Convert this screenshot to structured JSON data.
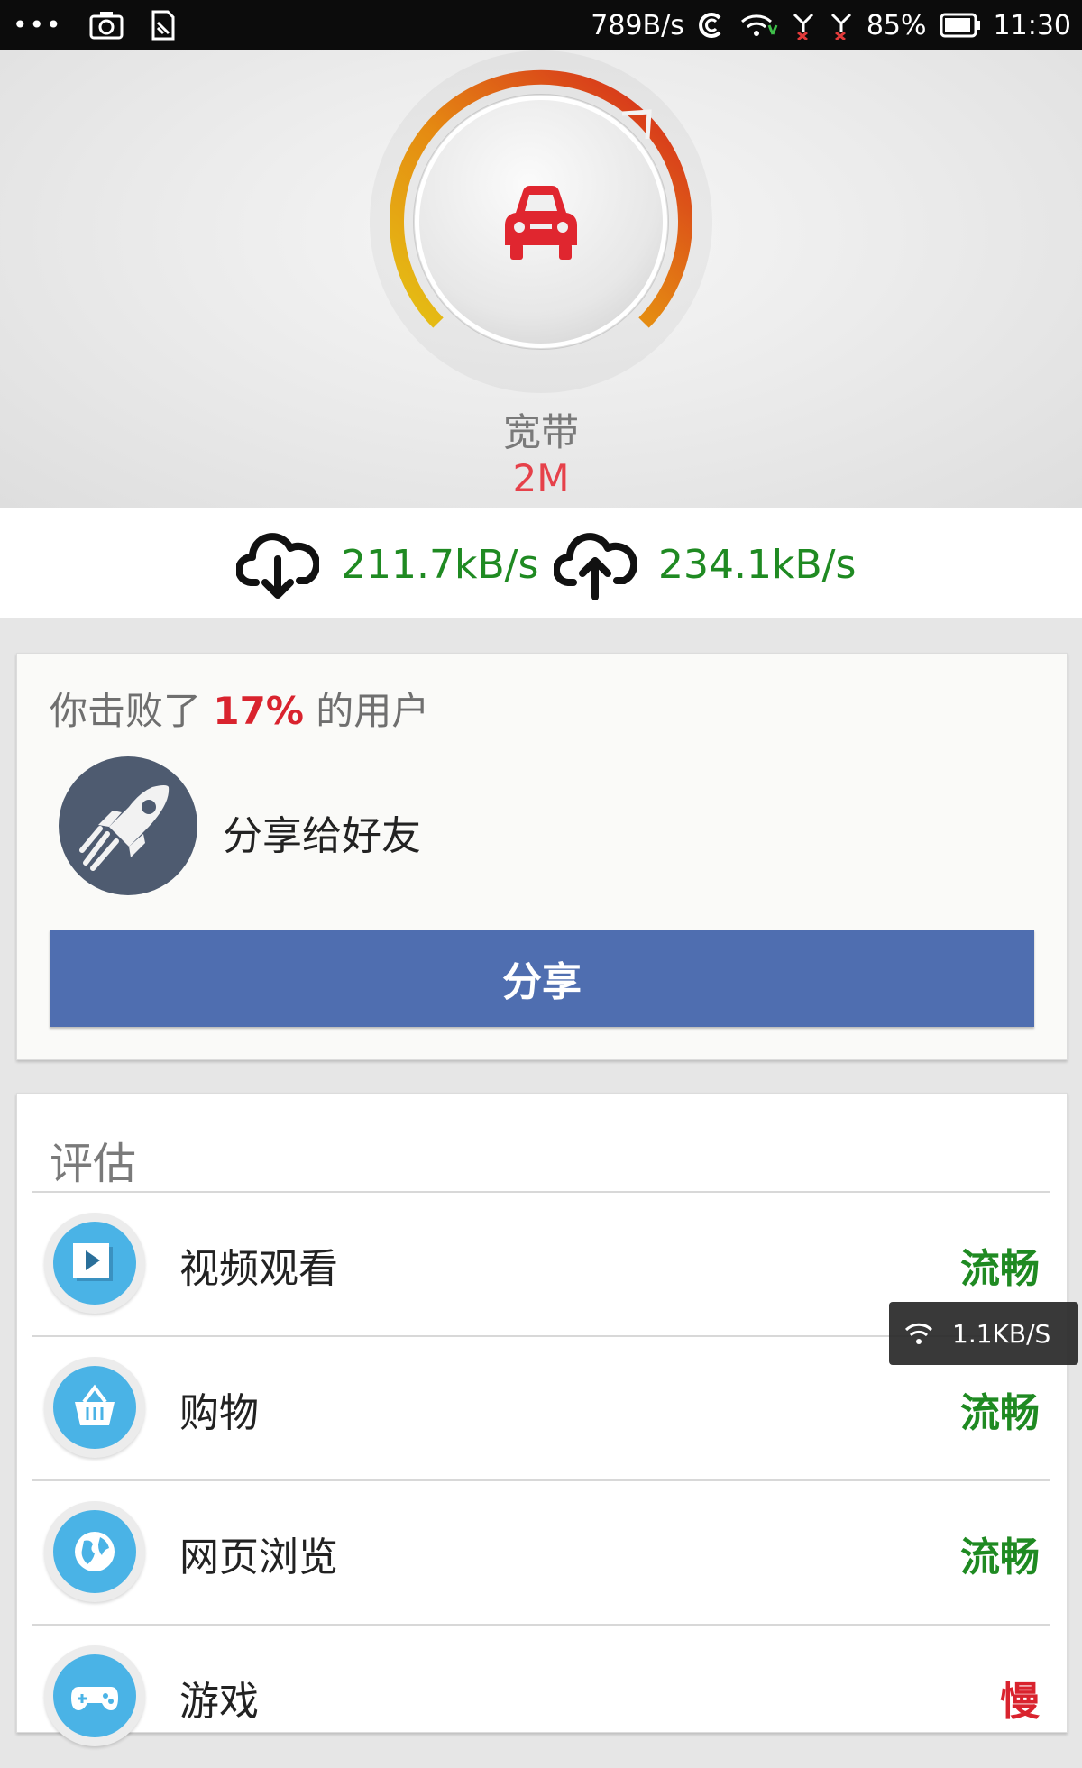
{
  "status_bar": {
    "net_speed": "789B/s",
    "battery": "85%",
    "time": "11:30"
  },
  "header": {
    "type_label": "宽带",
    "bandwidth": "2M"
  },
  "speeds": {
    "download": "211.7kB/s",
    "upload": "234.1kB/s"
  },
  "share_card": {
    "beat_prefix": "你击败了",
    "beat_percent": "17%",
    "beat_suffix": "的用户",
    "share_to_friends": "分享给好友",
    "share_button": "分享"
  },
  "evaluation": {
    "title": "评估",
    "items": [
      {
        "label": "视频观看",
        "status": "流畅"
      },
      {
        "label": "购物",
        "status": "流畅"
      },
      {
        "label": "网页浏览",
        "status": "流畅"
      },
      {
        "label": "游戏",
        "status": "慢"
      }
    ]
  },
  "floating_toast": {
    "speed": "1.1KB/S"
  },
  "colors": {
    "good": "#1f8a22",
    "bad": "#d9232e",
    "accent_blue": "#4f6eb0",
    "icon_blue": "#4ab3e6"
  }
}
